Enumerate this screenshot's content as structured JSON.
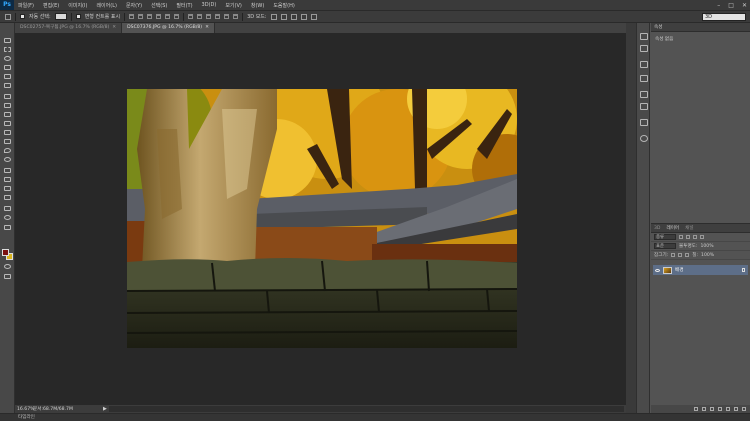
{
  "app": {
    "logo": "Ps"
  },
  "menu": [
    "파일(F)",
    "편집(E)",
    "이미지(I)",
    "레이어(L)",
    "문자(Y)",
    "선택(S)",
    "필터(T)",
    "3D(D)",
    "보기(V)",
    "창(W)",
    "도움말(H)"
  ],
  "window_controls": [
    "–",
    "□",
    "✕"
  ],
  "options": {
    "auto_select_label": "자동 선택:",
    "transform_label": "변형 컨트롤 표시",
    "mode_3d_label": "3D 모드:",
    "workspace_value": "3D"
  },
  "tabs": [
    {
      "label": "DSC02757-복구됨.JPG @ 16.7% (RGB/8)",
      "close": "✕",
      "active": false
    },
    {
      "label": "DSC07376.JPG @ 16.7% (RGB/8)",
      "close": "✕",
      "active": true
    }
  ],
  "status": {
    "zoom": "16.67%",
    "doc_info": "문서:68.7M/68.7M",
    "arrow": "▶"
  },
  "timeline_label": "타임라인",
  "properties": {
    "tabs": [
      "속성"
    ],
    "empty_text": "속성 없음"
  },
  "layers": {
    "tabs": [
      "3D",
      "레이어",
      "채널"
    ],
    "kind_label": "종류",
    "blend_mode": "표준",
    "opacity_label": "불투명도:",
    "opacity_value": "100%",
    "lock_label": "잠그기:",
    "fill_label": "칠:",
    "fill_value": "100%",
    "items": [
      {
        "name": "배경",
        "visible": true,
        "locked": true
      }
    ]
  },
  "colors": {
    "foreground": "#7a1010",
    "background": "#d8b420"
  },
  "icons": {
    "toolbar": [
      "move-icon",
      "marquee-icon",
      "lasso-icon",
      "quick-select-icon",
      "crop-icon",
      "eyedropper-icon",
      "healing-brush-icon",
      "brush-icon",
      "clone-stamp-icon",
      "history-brush-icon",
      "eraser-icon",
      "gradient-icon",
      "blur-icon",
      "dodge-icon",
      "pen-icon",
      "type-icon",
      "path-select-icon",
      "shape-icon",
      "hand-icon",
      "zoom-icon"
    ]
  }
}
